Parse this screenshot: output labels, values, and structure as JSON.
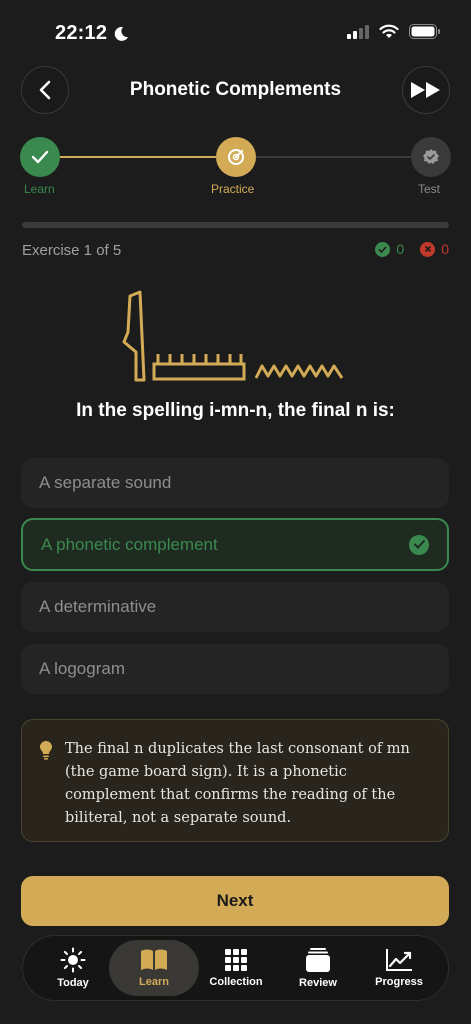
{
  "status_bar": {
    "time": "22:12"
  },
  "header": {
    "title": "Phonetic Complements"
  },
  "stepper": {
    "steps": [
      {
        "label": "Learn",
        "state": "completed"
      },
      {
        "label": "Practice",
        "state": "current"
      },
      {
        "label": "Test",
        "state": "locked"
      }
    ]
  },
  "exercise": {
    "counter": "Exercise 1 of 5",
    "correct_count": "0",
    "wrong_count": "0",
    "progress": 0,
    "question": "In the spelling i-mn-n, the final n is:",
    "options": [
      {
        "label": "A separate sound",
        "state": "default"
      },
      {
        "label": "A phonetic complement",
        "state": "correct"
      },
      {
        "label": "A determinative",
        "state": "default"
      },
      {
        "label": "A logogram",
        "state": "default"
      }
    ],
    "explanation": "The final n duplicates the last consonant of mn (the game board sign). It is a phonetic complement that confirms the reading of the biliteral, not a separate sound."
  },
  "next_button": {
    "label": "Next"
  },
  "tabbar": {
    "tabs": [
      {
        "label": "Today",
        "icon": "sun-icon"
      },
      {
        "label": "Learn",
        "icon": "book-icon",
        "active": true
      },
      {
        "label": "Collection",
        "icon": "grid-icon"
      },
      {
        "label": "Review",
        "icon": "cards-icon"
      },
      {
        "label": "Progress",
        "icon": "chart-icon"
      }
    ]
  },
  "colors": {
    "accent": "#d3ab56",
    "success": "#3a8a4f",
    "error": "#c0392b",
    "background": "#1c1c1c"
  }
}
